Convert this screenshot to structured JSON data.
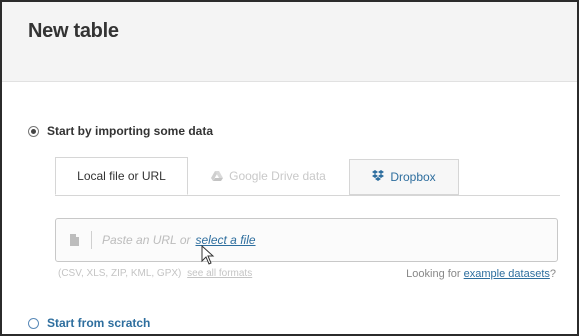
{
  "header": {
    "title": "New table"
  },
  "import_option": {
    "label": "Start by importing some data",
    "selected": true
  },
  "tabs": [
    {
      "label": "Local file or URL",
      "state": "active",
      "icon": ""
    },
    {
      "label": "Google Drive data",
      "state": "disabled",
      "icon": "google-drive-icon"
    },
    {
      "label": "Dropbox",
      "state": "inactive",
      "icon": "dropbox-icon"
    }
  ],
  "url_input": {
    "placeholder_prefix": "Paste an URL or",
    "select_link": "select a file",
    "icon": "document-icon"
  },
  "formats": {
    "list": "(CSV, XLS, ZIP, KML, GPX)",
    "see_all": "see all formats"
  },
  "examples": {
    "prefix": "Looking for",
    "link": "example datasets",
    "suffix": "?"
  },
  "scratch_option": {
    "label": "Start from scratch",
    "selected": false
  },
  "colors": {
    "link": "#2e6e9e",
    "header_bg": "#f4f4f4",
    "border": "#d6d6d6"
  }
}
